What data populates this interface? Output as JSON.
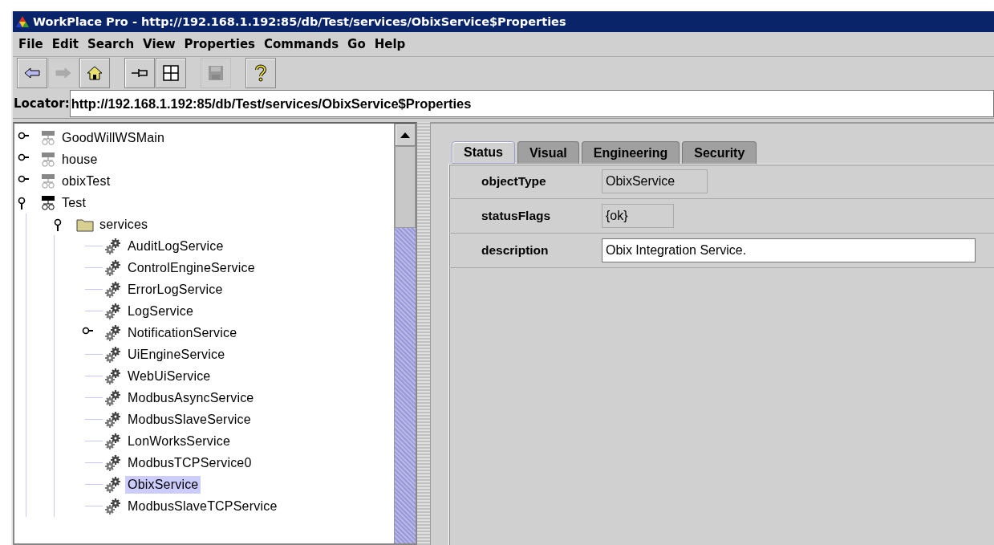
{
  "window": {
    "title": "WorkPlace Pro - http://192.168.1.192:85/db/Test/services/ObixService$Properties"
  },
  "menu": [
    "File",
    "Edit",
    "Search",
    "View",
    "Properties",
    "Commands",
    "Go",
    "Help"
  ],
  "toolbar": [
    {
      "kind": "back",
      "disabled": false
    },
    {
      "kind": "forward",
      "disabled": true
    },
    {
      "kind": "home",
      "disabled": false
    },
    {
      "kind": "separator"
    },
    {
      "kind": "pin",
      "disabled": false
    },
    {
      "kind": "grid",
      "disabled": false
    },
    {
      "kind": "separator"
    },
    {
      "kind": "save",
      "disabled": true
    },
    {
      "kind": "separator"
    },
    {
      "kind": "help",
      "disabled": false
    }
  ],
  "locator": {
    "label": "Locator:",
    "value": "http://192.168.1.192:85/db/Test/services/ObixService$Properties"
  },
  "tree": [
    {
      "label": "GoodWillWSMain",
      "kind": "station",
      "connected": false,
      "expanded": false,
      "selected": false
    },
    {
      "label": "house",
      "kind": "station",
      "connected": false,
      "expanded": false,
      "selected": false
    },
    {
      "label": "obixTest",
      "kind": "station",
      "connected": false,
      "expanded": false,
      "selected": false
    },
    {
      "label": "Test",
      "kind": "station",
      "connected": true,
      "expanded": true,
      "selected": false,
      "children": [
        {
          "label": "services",
          "kind": "folder",
          "expanded": true,
          "selected": false,
          "children": [
            {
              "label": "AuditLogService",
              "kind": "service",
              "selected": false
            },
            {
              "label": "ControlEngineService",
              "kind": "service",
              "selected": false
            },
            {
              "label": "ErrorLogService",
              "kind": "service",
              "selected": false
            },
            {
              "label": "LogService",
              "kind": "service",
              "selected": false
            },
            {
              "label": "NotificationService",
              "kind": "service",
              "expanded": false,
              "selected": false
            },
            {
              "label": "UiEngineService",
              "kind": "service",
              "selected": false
            },
            {
              "label": "WebUiService",
              "kind": "service",
              "selected": false
            },
            {
              "label": "ModbusAsyncService",
              "kind": "service",
              "selected": false
            },
            {
              "label": "ModbusSlaveService",
              "kind": "service",
              "selected": false
            },
            {
              "label": "LonWorksService",
              "kind": "service",
              "selected": false
            },
            {
              "label": "ModbusTCPService0",
              "kind": "service",
              "selected": false
            },
            {
              "label": "ObixService",
              "kind": "service",
              "selected": true
            },
            {
              "label": "ModbusSlaveTCPService",
              "kind": "service",
              "selected": false
            }
          ]
        }
      ]
    }
  ],
  "tabs": [
    {
      "label": "Status",
      "selected": true
    },
    {
      "label": "Visual",
      "selected": false
    },
    {
      "label": "Engineering",
      "selected": false
    },
    {
      "label": "Security",
      "selected": false
    }
  ],
  "properties": [
    {
      "name": "objectType",
      "value": "ObixService",
      "kind": "readonly"
    },
    {
      "name": "statusFlags",
      "value": "{ok}",
      "kind": "readonly"
    },
    {
      "name": "description",
      "value": "Obix Integration Service.",
      "kind": "editable"
    }
  ]
}
